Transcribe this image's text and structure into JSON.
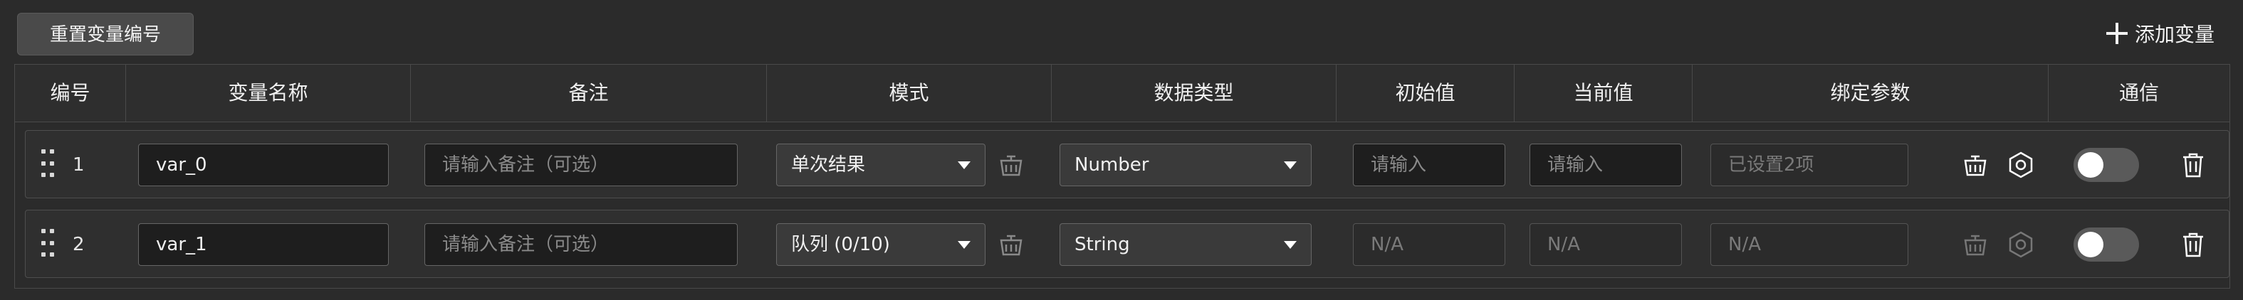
{
  "toolbar": {
    "reset_label": "重置变量编号",
    "add_label": "添加变量"
  },
  "columns": [
    "编号",
    "变量名称",
    "备注",
    "模式",
    "数据类型",
    "初始值",
    "当前值",
    "绑定参数",
    "通信"
  ],
  "rows": [
    {
      "index": "1",
      "name": "var_0",
      "remark_placeholder": "请输入备注（可选）",
      "mode": "单次结果",
      "data_type": "Number",
      "initial_value": "请输入",
      "current_value": "请输入",
      "binding": "已设置2项",
      "comm_enabled": false
    },
    {
      "index": "2",
      "name": "var_1",
      "remark_placeholder": "请输入备注（可选）",
      "mode": "队列 (0/10)",
      "data_type": "String",
      "initial_value": "N/A",
      "current_value": "N/A",
      "binding": "N/A",
      "comm_enabled": false
    }
  ],
  "icons": {
    "add": "plus-icon",
    "drag": "drag-handle-icon",
    "clear": "basket-icon",
    "settings": "hexagon-settings-icon",
    "delete": "trash-icon"
  },
  "colors": {
    "background": "#2b2b2b",
    "input_bg": "#1e1e1e",
    "select_bg": "#3a3a3a",
    "border": "#4a4a4a",
    "toggle_off": "#5a5a5a"
  }
}
